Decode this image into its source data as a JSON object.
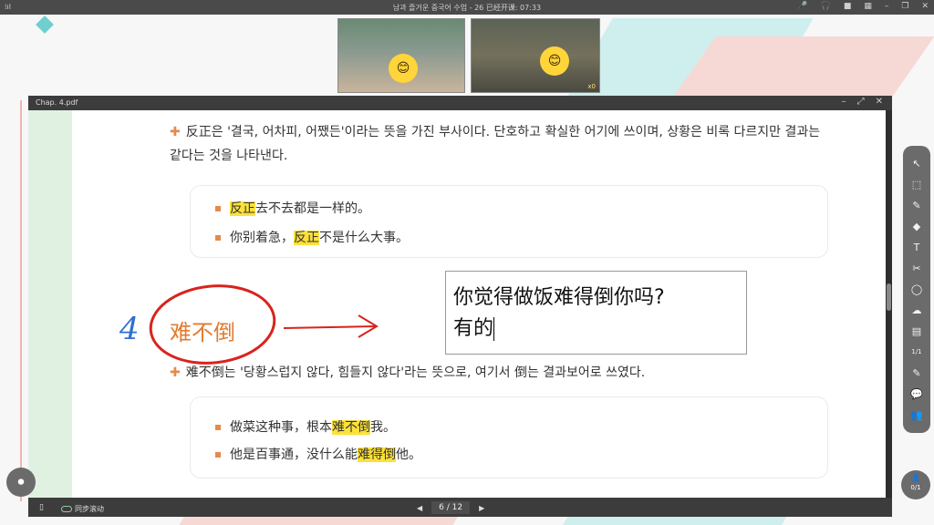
{
  "topbar": {
    "signal": "⁞ıl",
    "title": "남과 즐거운 중국어 수업 - 26    已经开课: 07:33",
    "icons": [
      "mic-icon",
      "headset-icon",
      "camera-icon",
      "grid-icon",
      "minimize-icon",
      "restore-icon",
      "close-icon"
    ]
  },
  "videos": [
    {
      "face": "😊",
      "badge": ""
    },
    {
      "face": "😊",
      "badge": "x0"
    }
  ],
  "pdf": {
    "filename": "Chap. 4.pdf",
    "window_controls": [
      "–",
      "⤢",
      "✕"
    ],
    "para1": "反正은 '결국, 어차피, 어쨌든'이라는 뜻을 가진 부사이다. 단호하고 확실한 어기에 쓰이며, 상황은 비록 다르지만 결과는 같다는 것을 나타낸다.",
    "box1": {
      "line1": {
        "hl": "反正",
        "rest": "去不去都是一样的。"
      },
      "line2": {
        "pre": "你别着急，",
        "hl": "反正",
        "rest": "不是什么大事。"
      }
    },
    "number": "4",
    "heading": "难不倒",
    "arrow": "→",
    "textbox": {
      "line1": "你觉得做饭难得倒你吗?",
      "line2": "有的"
    },
    "para2": "难不倒는 '당황스럽지 않다, 힘들지 않다'라는 뜻으로, 여기서 倒는 결과보어로 쓰였다.",
    "box2": {
      "line1": {
        "pre": "做菜这种事，根本",
        "hl": "难不倒",
        "rest": "我。"
      },
      "line2": {
        "pre": "他是百事通，没什么能",
        "hl": "难得倒",
        "rest": "他。"
      }
    },
    "bottom": {
      "panel_icon": "▯",
      "sync_label": "同步滚动",
      "prev": "◀",
      "page": "6 / 12",
      "next": "▶"
    }
  },
  "toolbar": {
    "tools": [
      {
        "name": "pointer-icon",
        "glyph": "↖"
      },
      {
        "name": "select-icon",
        "glyph": "⬚"
      },
      {
        "name": "pen-icon",
        "glyph": "✎"
      },
      {
        "name": "eraser-icon",
        "glyph": "◆"
      },
      {
        "name": "text-icon",
        "glyph": "T"
      },
      {
        "name": "scissors-icon",
        "glyph": "✂"
      },
      {
        "name": "shape-icon",
        "glyph": "◯"
      },
      {
        "name": "cloud-icon",
        "glyph": "☁"
      },
      {
        "name": "briefcase-icon",
        "glyph": "▤"
      },
      {
        "name": "zoom-icon",
        "glyph": "1/1"
      },
      {
        "name": "edit-icon",
        "glyph": "✎"
      },
      {
        "name": "chat-icon",
        "glyph": "💬"
      },
      {
        "name": "users-icon",
        "glyph": "👥"
      }
    ]
  },
  "participants": {
    "icon": "👤",
    "count": "0/1"
  },
  "record": {
    "icon": "⏺"
  }
}
